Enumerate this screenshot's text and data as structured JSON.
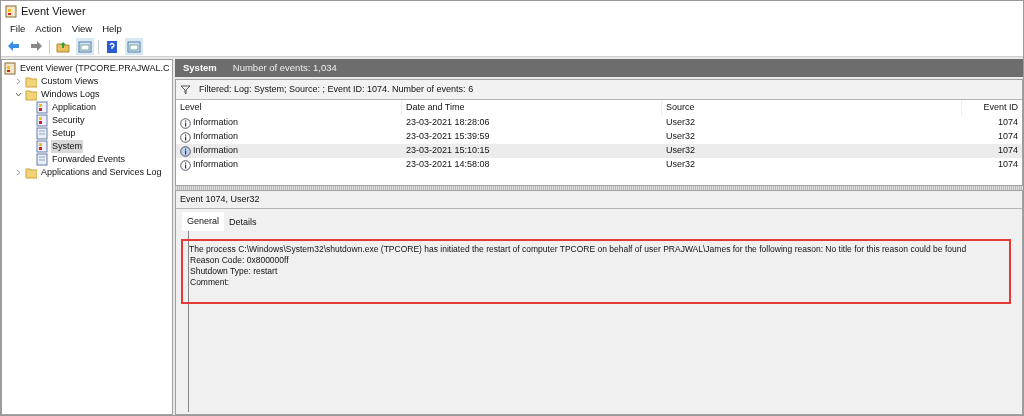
{
  "window": {
    "title": "Event Viewer"
  },
  "menu": [
    "File",
    "Action",
    "View",
    "Help"
  ],
  "toolbar": [
    {
      "kind": "back"
    },
    {
      "kind": "forward"
    },
    {
      "kind": "folder"
    },
    {
      "kind": "panel"
    },
    {
      "kind": "help"
    },
    {
      "kind": "panel"
    }
  ],
  "tree": {
    "label": "Event Viewer (TPCORE.PRAJWAL.C",
    "children": [
      {
        "label": "Custom Views",
        "kind": "folder",
        "expanded": false,
        "selected": false
      },
      {
        "label": "Windows Logs",
        "kind": "folder",
        "expanded": true,
        "selected": false,
        "children": [
          {
            "label": "Application",
            "kind": "log",
            "selected": false
          },
          {
            "label": "Security",
            "kind": "log",
            "selected": false
          },
          {
            "label": "Setup",
            "kind": "plain",
            "selected": false
          },
          {
            "label": "System",
            "kind": "log",
            "selected": true
          },
          {
            "label": "Forwarded Events",
            "kind": "plain",
            "selected": false
          }
        ]
      },
      {
        "label": "Applications and Services Log",
        "kind": "folder",
        "expanded": false,
        "selected": false
      }
    ]
  },
  "header": {
    "title": "System",
    "count": "Number of events: 1,034"
  },
  "filter": "Filtered: Log: System; Source: ; Event ID: 1074. Number of events: 6",
  "table": {
    "columns": [
      "Level",
      "Date and Time",
      "Source",
      "Event ID"
    ],
    "rows": [
      {
        "level": "Information",
        "date": "23-03-2021 18:28:06",
        "source": "User32",
        "id": "1074",
        "selected": false
      },
      {
        "level": "Information",
        "date": "23-03-2021 15:39:59",
        "source": "User32",
        "id": "1074",
        "selected": false
      },
      {
        "level": "Information",
        "date": "23-03-2021 15:10:15",
        "source": "User32",
        "id": "1074",
        "selected": true
      },
      {
        "level": "Information",
        "date": "23-03-2021 14:58:08",
        "source": "User32",
        "id": "1074",
        "selected": false
      }
    ]
  },
  "details": {
    "title": "Event 1074, User32",
    "tabs": [
      {
        "label": "General",
        "selected": true
      },
      {
        "label": "Details",
        "selected": false
      }
    ],
    "highlighted": true,
    "lines": [
      "The process C:\\Windows\\System32\\shutdown.exe (TPCORE) has initiated the restart of computer TPCORE on behalf of user PRAJWAL\\James for the following reason: No title for this reason could be found",
      "Reason Code: 0x800000ff",
      "Shutdown Type: restart",
      "Comment:"
    ]
  }
}
